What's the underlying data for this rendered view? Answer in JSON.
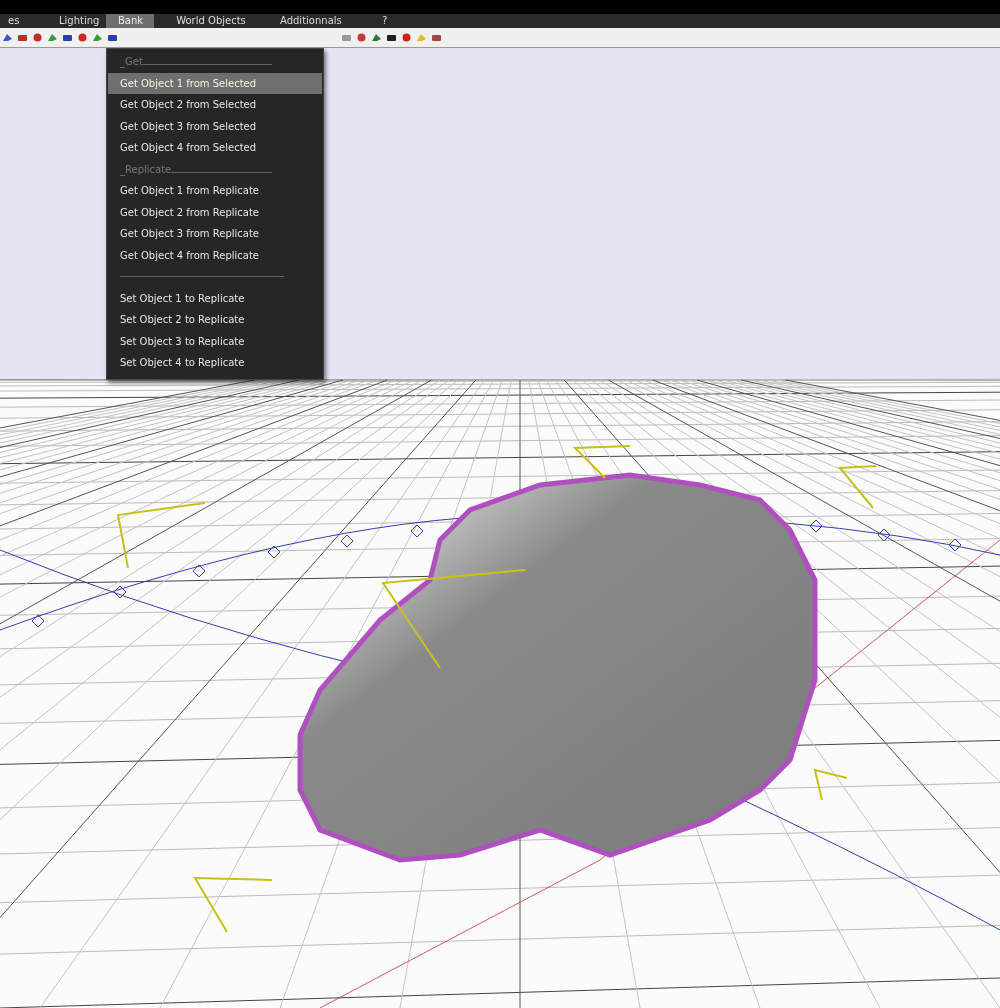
{
  "menu_bar": [
    {
      "label": "es",
      "selected": false
    },
    {
      "label": "Lighting",
      "selected": false
    },
    {
      "label": "Bank",
      "selected": true
    },
    {
      "label": "World Objects",
      "selected": false
    },
    {
      "label": "Additionnals",
      "selected": false
    },
    {
      "label": "?",
      "selected": false
    }
  ],
  "bank_menu": {
    "items": [
      {
        "kind": "header",
        "label": "_Get"
      },
      {
        "kind": "item",
        "label": "Get Object 1 from Selected",
        "selected": true
      },
      {
        "kind": "item",
        "label": "Get Object 2 from Selected",
        "selected": false
      },
      {
        "kind": "item",
        "label": "Get Object 3 from Selected",
        "selected": false
      },
      {
        "kind": "item",
        "label": "Get Object 4 from Selected",
        "selected": false
      },
      {
        "kind": "header",
        "label": "_Replicate"
      },
      {
        "kind": "item",
        "label": "Get Object 1 from Replicate",
        "selected": false
      },
      {
        "kind": "item",
        "label": "Get Object 2 from Replicate",
        "selected": false
      },
      {
        "kind": "item",
        "label": "Get Object 3 from Replicate",
        "selected": false
      },
      {
        "kind": "item",
        "label": "Get Object 4 from Replicate",
        "selected": false
      },
      {
        "kind": "separator"
      },
      {
        "kind": "item",
        "label": "Set Object 1 to Replicate",
        "selected": false
      },
      {
        "kind": "item",
        "label": "Set Object 2 to Replicate",
        "selected": false
      },
      {
        "kind": "item",
        "label": "Set Object 3 to Replicate",
        "selected": false
      },
      {
        "kind": "item",
        "label": "Set Object 4 to Replicate",
        "selected": false
      }
    ]
  }
}
